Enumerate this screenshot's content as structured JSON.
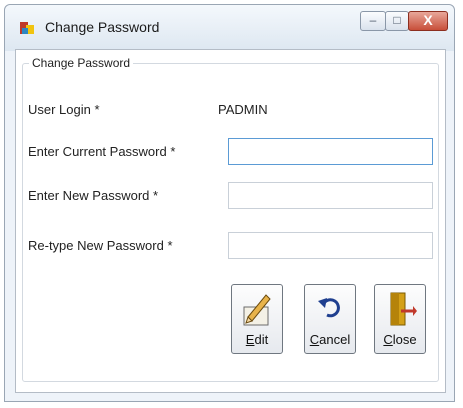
{
  "window": {
    "title": "Change Password"
  },
  "title_controls": {
    "minimize": "–",
    "maximize": "□",
    "close": "X"
  },
  "group": {
    "legend": "Change Password"
  },
  "fields": {
    "user_login": {
      "label": "User Login *",
      "value": "PADMIN"
    },
    "current_password": {
      "label": "Enter Current Password *",
      "value": ""
    },
    "new_password": {
      "label": "Enter New Password *",
      "value": ""
    },
    "retype_password": {
      "label": "Re-type New Password *",
      "value": ""
    }
  },
  "buttons": {
    "edit": {
      "accel": "E",
      "rest": "dit"
    },
    "cancel": {
      "accel": "C",
      "rest": "ancel"
    },
    "close": {
      "accel": "C",
      "rest": "lose"
    }
  },
  "colors": {
    "focus_border": "#5b9bd5",
    "close_button": "#c84f3a"
  }
}
